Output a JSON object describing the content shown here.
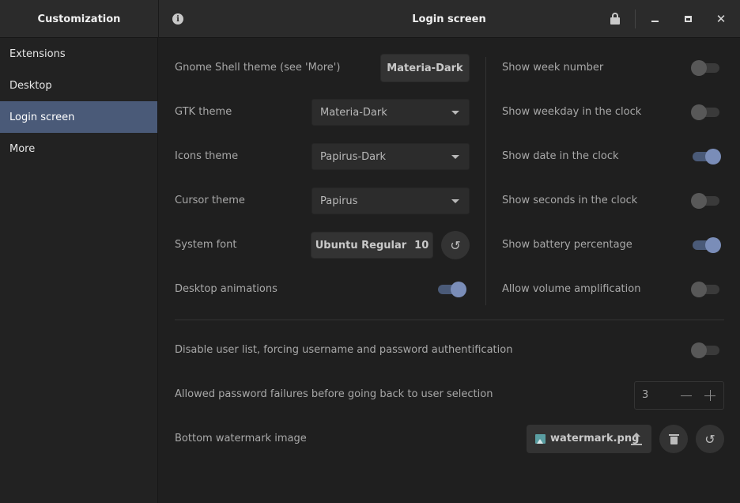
{
  "header": {
    "app_title": "Customization",
    "page_title": "Login screen",
    "icons": {
      "info": "info-icon",
      "lock": "lock-icon",
      "minimize": "minimize-icon",
      "maximize": "maximize-icon",
      "close": "close-icon"
    },
    "close_glyph": "✕"
  },
  "sidebar": {
    "items": [
      {
        "label": "Extensions"
      },
      {
        "label": "Desktop"
      },
      {
        "label": "Login screen",
        "active": true
      },
      {
        "label": "More"
      }
    ]
  },
  "left_settings": {
    "shell_theme": {
      "label": "Gnome Shell theme (see 'More')",
      "value": "Materia-Dark"
    },
    "gtk_theme": {
      "label": "GTK theme",
      "value": "Materia-Dark"
    },
    "icons_theme": {
      "label": "Icons theme",
      "value": "Papirus-Dark"
    },
    "cursor_theme": {
      "label": "Cursor theme",
      "value": "Papirus"
    },
    "system_font": {
      "label": "System font",
      "value": "Ubuntu Regular",
      "size": "10",
      "reset_glyph": "↺"
    },
    "desktop_animations": {
      "label": "Desktop animations",
      "on": true
    }
  },
  "right_settings": {
    "show_week_number": {
      "label": "Show week number",
      "on": false
    },
    "show_weekday": {
      "label": "Show weekday in the clock",
      "on": false
    },
    "show_date": {
      "label": "Show date in the clock",
      "on": true
    },
    "show_seconds": {
      "label": "Show seconds in the clock",
      "on": false
    },
    "show_battery": {
      "label": "Show battery percentage",
      "on": true
    },
    "volume_amplification": {
      "label": "Allow volume amplification",
      "on": false
    }
  },
  "bottom_settings": {
    "disable_user_list": {
      "label": "Disable user list, forcing username and password authentification",
      "on": false
    },
    "password_failures": {
      "label": "Allowed password failures before going back to user selection",
      "value": "3"
    },
    "watermark": {
      "label": "Bottom watermark image",
      "file": "watermark.png",
      "reset_glyph": "↺"
    }
  },
  "colors": {
    "accent": "#4a5a78",
    "knob_on": "#7a8db8",
    "background": "#1f1f1f",
    "sidebar": "#222222"
  }
}
